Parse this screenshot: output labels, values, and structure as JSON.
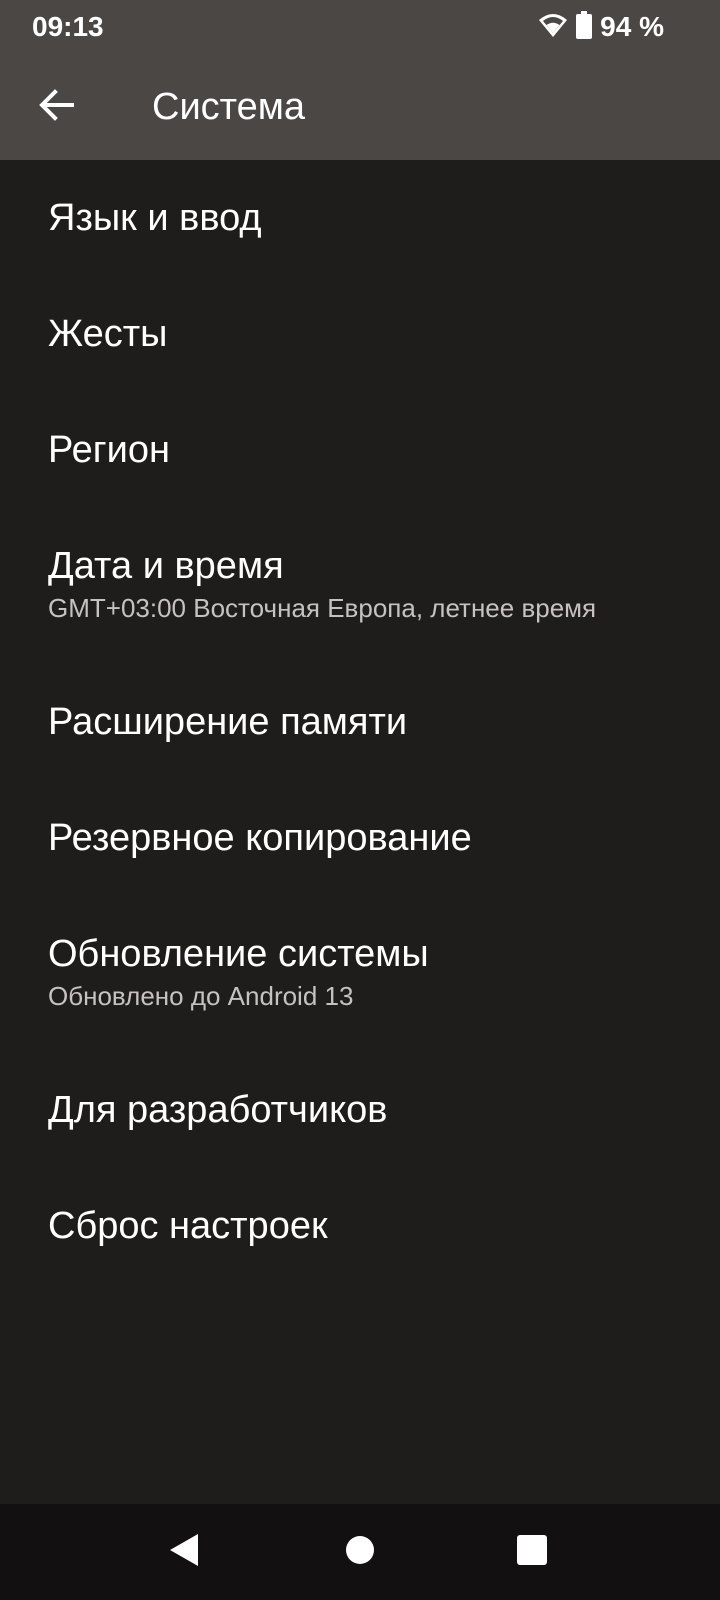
{
  "status_bar": {
    "time": "09:13",
    "battery_level": "94 %",
    "icons": [
      "wifi-icon",
      "battery-icon"
    ]
  },
  "app_bar": {
    "title": "Система",
    "back_icon": "arrow-back-icon"
  },
  "items": [
    {
      "title": "Язык и ввод",
      "summary": ""
    },
    {
      "title": "Жесты",
      "summary": ""
    },
    {
      "title": "Регион",
      "summary": ""
    },
    {
      "title": "Дата и время",
      "summary": "GMT+03:00 Восточная Европа, летнее время"
    },
    {
      "title": "Расширение памяти",
      "summary": ""
    },
    {
      "title": "Резервное копирование",
      "summary": ""
    },
    {
      "title": "Обновление системы",
      "summary": "Обновлено до Android 13"
    },
    {
      "title": "Для разработчиков",
      "summary": ""
    },
    {
      "title": "Сброс настроек",
      "summary": ""
    }
  ],
  "nav_bar": {
    "icons": [
      "nav-back-icon",
      "nav-home-icon",
      "nav-recents-icon"
    ]
  },
  "colors": {
    "background": "#1f1c1c",
    "app_bar": "#4a4745",
    "nav_bar": "#121010",
    "primary_text": "#ffffff",
    "secondary_text": "#c6c2c1"
  }
}
